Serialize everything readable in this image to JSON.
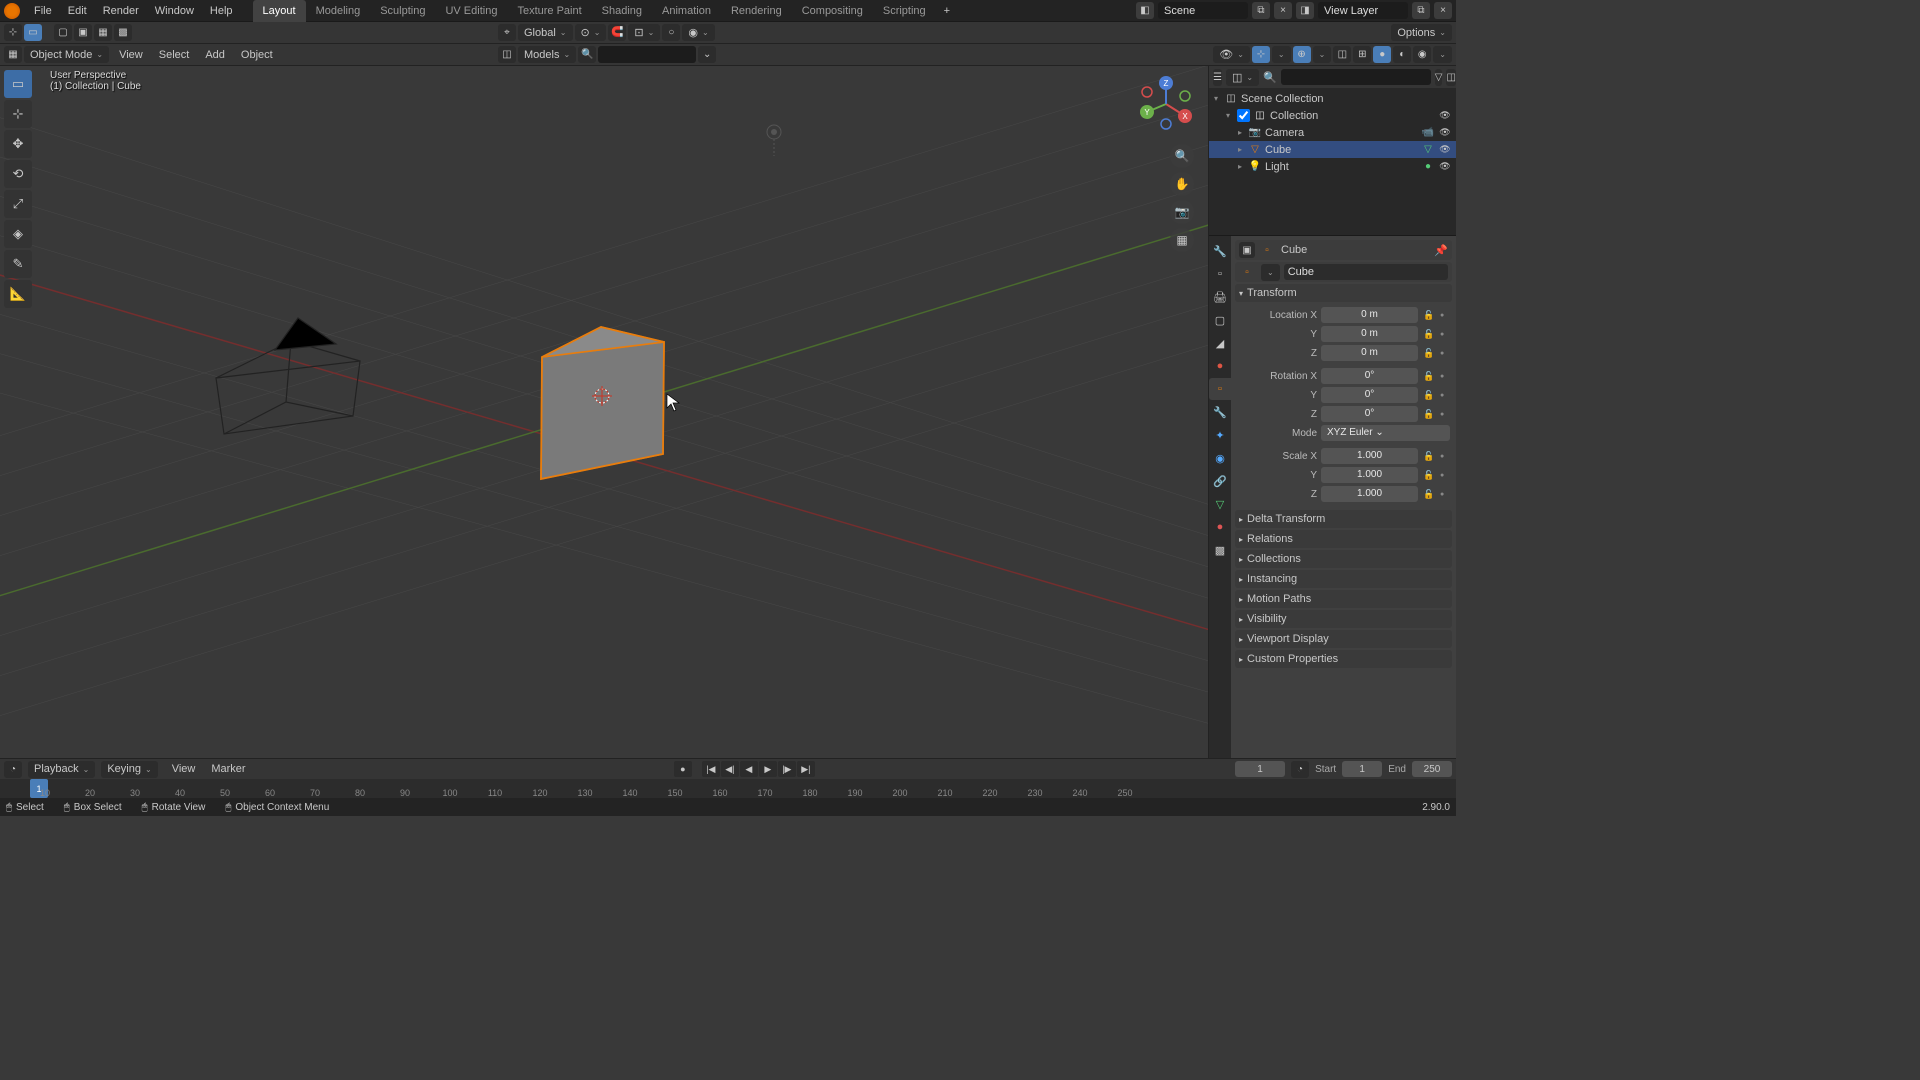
{
  "menus": [
    "File",
    "Edit",
    "Render",
    "Window",
    "Help"
  ],
  "workspaces": [
    "Layout",
    "Modeling",
    "Sculpting",
    "UV Editing",
    "Texture Paint",
    "Shading",
    "Animation",
    "Rendering",
    "Compositing",
    "Scripting"
  ],
  "active_workspace": "Layout",
  "scene_name": "Scene",
  "view_layer": "View Layer",
  "tool_header": {
    "transform_orientation": "Global",
    "options_label": "Options"
  },
  "secondary_header": {
    "mode": "Object Mode",
    "menus": [
      "View",
      "Select",
      "Add",
      "Object"
    ],
    "collection_name": "Models"
  },
  "viewport_info": {
    "view": "User Perspective",
    "context": "(1) Collection | Cube"
  },
  "outliner": {
    "scene_collection": "Scene Collection",
    "collection": "Collection",
    "items": [
      "Camera",
      "Cube",
      "Light"
    ],
    "selected": "Cube"
  },
  "properties": {
    "object_name": "Cube",
    "data_name": "Cube",
    "transform": {
      "label": "Transform",
      "location": {
        "label": "Location",
        "x": "0 m",
        "y": "0 m",
        "z": "0 m"
      },
      "rotation": {
        "label": "Rotation",
        "x": "0°",
        "y": "0°",
        "z": "0°"
      },
      "mode_label": "Mode",
      "mode": "XYZ Euler",
      "scale": {
        "label": "Scale",
        "x": "1.000",
        "y": "1.000",
        "z": "1.000"
      }
    },
    "panels": [
      "Delta Transform",
      "Relations",
      "Collections",
      "Instancing",
      "Motion Paths",
      "Visibility",
      "Viewport Display",
      "Custom Properties"
    ]
  },
  "timeline": {
    "playback": "Playback",
    "keying": "Keying",
    "menus": [
      "View",
      "Marker"
    ],
    "current": "1",
    "start_label": "Start",
    "start": "1",
    "end_label": "End",
    "end": "250",
    "ticks": [
      "10",
      "20",
      "30",
      "40",
      "50",
      "60",
      "70",
      "80",
      "90",
      "100",
      "110",
      "120",
      "130",
      "140",
      "150",
      "160",
      "170",
      "180",
      "190",
      "200",
      "210",
      "220",
      "230",
      "240",
      "250"
    ]
  },
  "status": {
    "select": "Select",
    "box_select": "Box Select",
    "rotate_view": "Rotate View",
    "context_menu": "Object Context Menu",
    "version": "2.90.0"
  },
  "axis_labels": {
    "x": "X",
    "y": "Y",
    "z": "Z"
  }
}
